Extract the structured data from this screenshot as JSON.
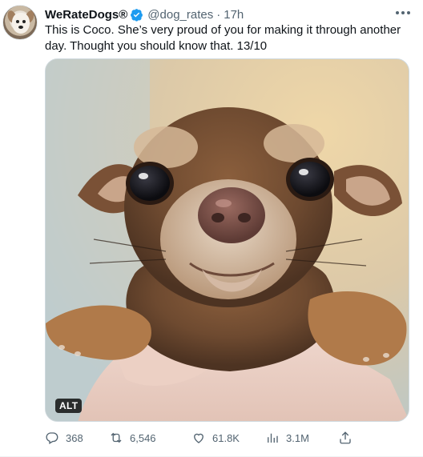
{
  "tweet": {
    "author": {
      "name": "WeRateDogs®",
      "handle": "@dog_rates",
      "separator": "·",
      "time": "17h",
      "verified_color": "#1d9bf0"
    },
    "text": "This is Coco. She’s very proud of you for making it through another day. Thought you should know that. 13/10",
    "media": {
      "alt_badge": "ALT"
    },
    "actions": {
      "replies": "368",
      "retweets": "6,546",
      "likes": "61.8K",
      "views": "3.1M"
    }
  },
  "icons": {
    "reply": "reply-icon",
    "retweet": "retweet-icon",
    "like": "heart-icon",
    "views": "views-icon",
    "share": "share-icon",
    "more": "more-icon",
    "verified": "verified-badge-icon"
  },
  "colors": {
    "text": "#0f1419",
    "muted": "#536471",
    "accent": "#1d9bf0"
  }
}
